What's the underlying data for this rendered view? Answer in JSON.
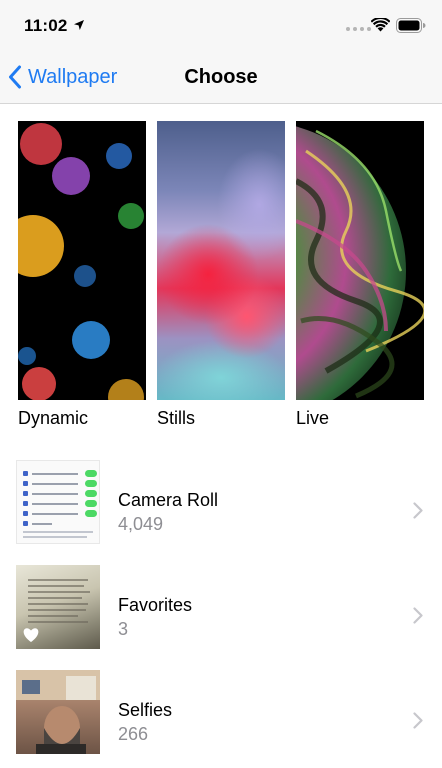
{
  "status_bar": {
    "time": "11:02"
  },
  "nav": {
    "back_label": "Wallpaper",
    "title": "Choose"
  },
  "wallpaper_categories": [
    {
      "label": "Dynamic"
    },
    {
      "label": "Stills"
    },
    {
      "label": "Live"
    }
  ],
  "albums": [
    {
      "title": "Camera Roll",
      "count": "4,049"
    },
    {
      "title": "Favorites",
      "count": "3"
    },
    {
      "title": "Selfies",
      "count": "266"
    }
  ],
  "colors": {
    "accent": "#1f7bf2",
    "secondary_text": "#8e8e93",
    "chevron": "#c7c7cc"
  }
}
